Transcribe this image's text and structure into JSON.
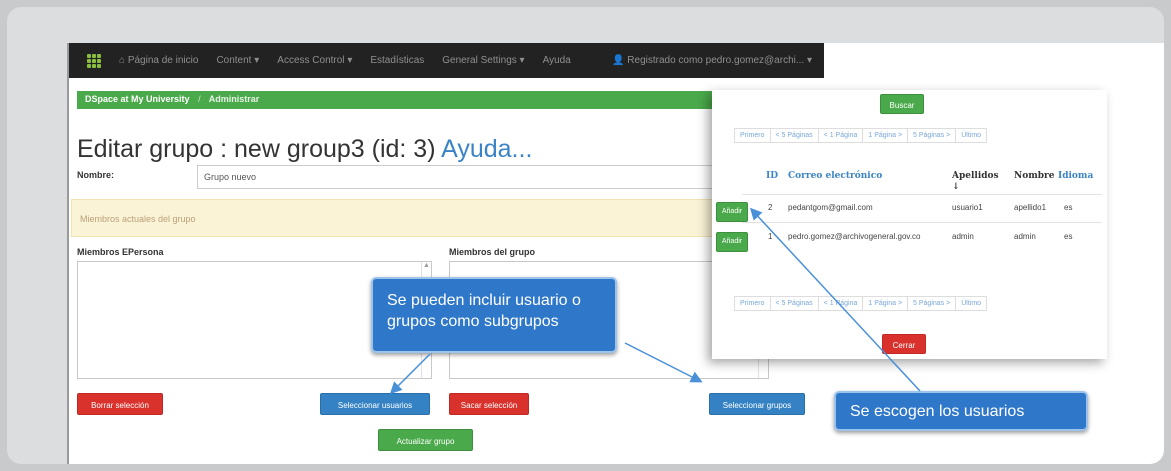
{
  "navbar": {
    "home": "Página de inicio",
    "content": "Content",
    "access_control": "Access Control",
    "stats": "Estadísticas",
    "general_settings": "General Settings",
    "help": "Ayuda",
    "user": "Registrado como pedro.gomez@archi..."
  },
  "breadcrumb": {
    "site": "DSpace at My University",
    "current": "Administrar"
  },
  "page": {
    "title": "Editar grupo : new group3 (id: 3)",
    "help_link": "Ayuda...",
    "name_label": "Nombre:",
    "name_value": "Grupo nuevo",
    "alert": "Miembros actuales del grupo",
    "eperson_label": "Miembros EPersona",
    "group_members_label": "Miembros del grupo"
  },
  "buttons": {
    "delete_selection": "Borrar selección",
    "select_users": "Seleccionar usuarios",
    "remove_selection": "Sacar selección",
    "select_groups": "Seleccionar grupos",
    "update_group": "Actualizar grupo"
  },
  "popup": {
    "search_button": "Buscar",
    "pager": [
      "Primero",
      "< 5 Páginas",
      "< 1 Página",
      "1 Página >",
      "5 Páginas >",
      "Último"
    ],
    "headers": {
      "id": "ID",
      "email": "Correo electrónico",
      "lastname": "Apellidos",
      "sort_arrow": "↓",
      "firstname": "Nombre",
      "language": "Idioma"
    },
    "rows": [
      {
        "add": "Añadir",
        "id": "2",
        "email": "pedantgom@gmail.com",
        "lastname": "usuario1",
        "firstname": "apellido1",
        "language": "es"
      },
      {
        "add": "Añadir",
        "id": "1",
        "email": "pedro.gomez@archivogeneral.gov.co",
        "lastname": "admin",
        "firstname": "admin",
        "language": "es"
      }
    ],
    "close_button": "Cerrar"
  },
  "callouts": {
    "include": "Se pueden incluir usuario o grupos como subgrupos",
    "choose_users": "Se escogen los usuarios"
  },
  "colors": {
    "navbar": "#222222",
    "success": "#4aa94a",
    "danger": "#d9322c",
    "primary": "#3482c4",
    "callout": "#2f78c9"
  }
}
